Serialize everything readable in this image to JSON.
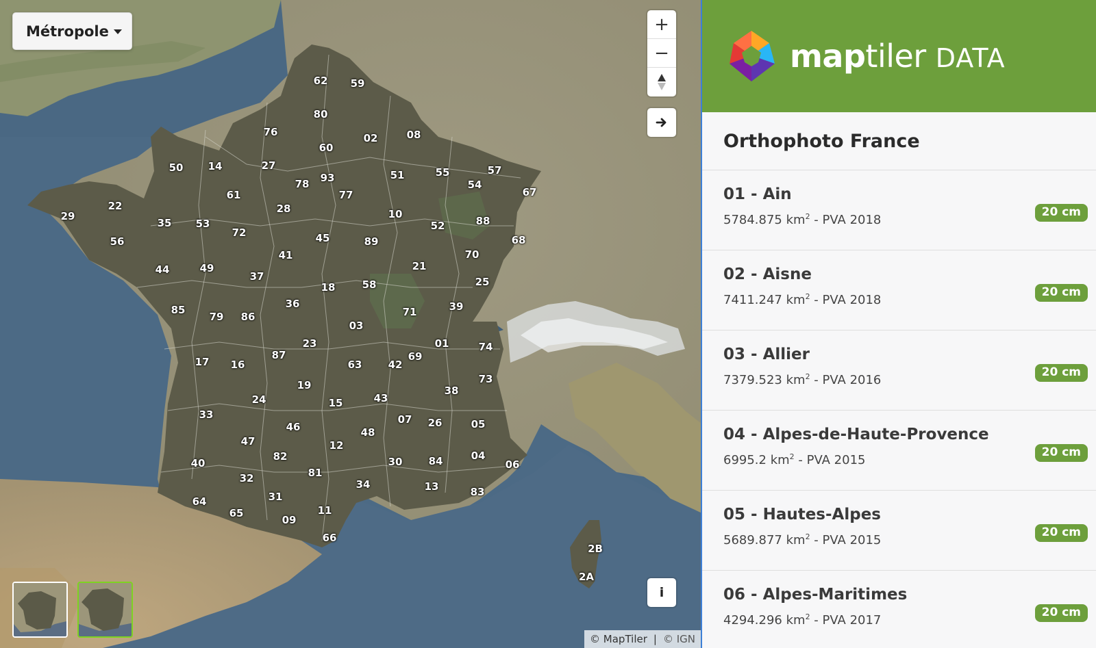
{
  "map": {
    "dropdown_label": "Métropole",
    "controls": {
      "zoom_in": "+",
      "zoom_out": "−",
      "compass": "▲",
      "arrow": "➔",
      "info": "i"
    },
    "attribution": {
      "maptiler": "© MapTiler",
      "separator": "|",
      "ign": "© IGN"
    },
    "departments": [
      "62",
      "59",
      "80",
      "76",
      "60",
      "02",
      "08",
      "50",
      "14",
      "27",
      "93",
      "78",
      "51",
      "55",
      "57",
      "77",
      "67",
      "54",
      "22",
      "61",
      "29",
      "35",
      "53",
      "28",
      "10",
      "72",
      "52",
      "88",
      "56",
      "45",
      "89",
      "68",
      "41",
      "44",
      "49",
      "70",
      "21",
      "37",
      "18",
      "58",
      "25",
      "85",
      "36",
      "71",
      "39",
      "79",
      "86",
      "03",
      "01",
      "23",
      "17",
      "87",
      "74",
      "16",
      "69",
      "42",
      "63",
      "19",
      "73",
      "38",
      "24",
      "15",
      "43",
      "33",
      "46",
      "07",
      "26",
      "05",
      "47",
      "12",
      "48",
      "82",
      "30",
      "84",
      "04",
      "40",
      "06",
      "81",
      "32",
      "34",
      "13",
      "83",
      "64",
      "31",
      "11",
      "65",
      "09",
      "66",
      "2B",
      "2A"
    ]
  },
  "sidebar": {
    "brand": {
      "part1": "map",
      "part2": "tiler",
      "part3": "DATA"
    },
    "title": "Orthophoto France",
    "datasets": [
      {
        "name": "01 - Ain",
        "area": "5784.875 km",
        "sup": "2",
        "source": " - PVA 2018",
        "badge": "20 cm"
      },
      {
        "name": "02 - Aisne",
        "area": "7411.247 km",
        "sup": "2",
        "source": " - PVA 2018",
        "badge": "20 cm"
      },
      {
        "name": "03 - Allier",
        "area": "7379.523 km",
        "sup": "2",
        "source": " - PVA 2016",
        "badge": "20 cm"
      },
      {
        "name": "04 - Alpes-de-Haute-Provence",
        "area": "6995.2 km",
        "sup": "2",
        "source": " - PVA 2015",
        "badge": "20 cm"
      },
      {
        "name": "05 - Hautes-Alpes",
        "area": "5689.877 km",
        "sup": "2",
        "source": " - PVA 2015",
        "badge": "20 cm"
      },
      {
        "name": "06 - Alpes-Maritimes",
        "area": "4294.296 km",
        "sup": "2",
        "source": " - PVA 2017",
        "badge": "20 cm"
      }
    ]
  },
  "colors": {
    "brand_green": "#6d9f3c",
    "sea": "#4f6e87",
    "land_terrain": "#a59a7e",
    "france_imagery": "#5b5a48",
    "snow": "#e8ecef"
  }
}
